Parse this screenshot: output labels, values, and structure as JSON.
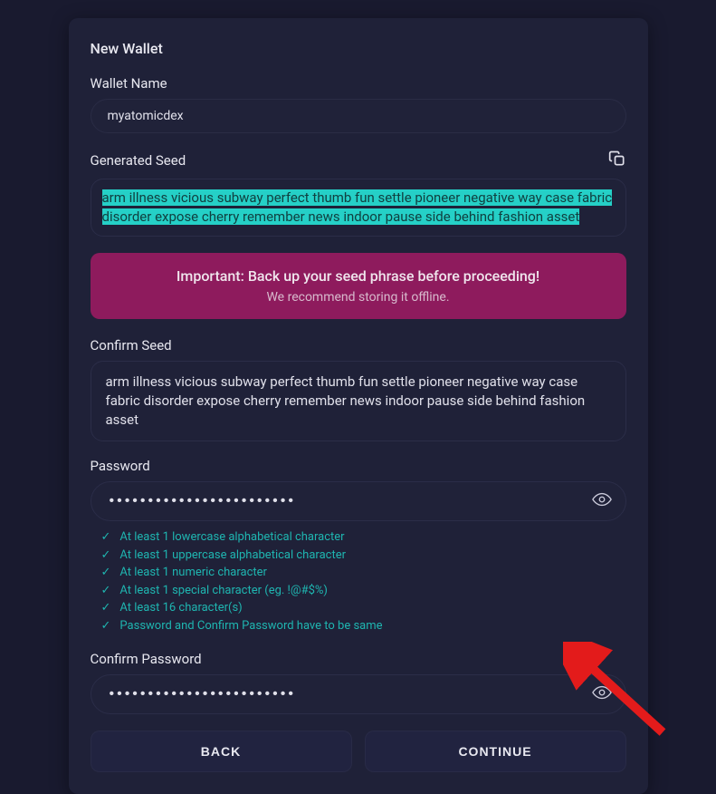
{
  "title": "New Wallet",
  "walletName": {
    "label": "Wallet Name",
    "value": "myatomicdex"
  },
  "generatedSeed": {
    "label": "Generated Seed",
    "value": "arm illness vicious subway perfect thumb fun settle pioneer negative way case fabric disorder expose cherry remember news indoor pause side behind fashion asset"
  },
  "important": {
    "title": "Important: Back up your seed phrase before proceeding!",
    "sub": "We recommend storing it offline."
  },
  "confirmSeed": {
    "label": "Confirm Seed",
    "value": "arm illness vicious subway perfect thumb fun settle pioneer negative way case fabric disorder expose cherry remember news indoor pause side behind fashion asset"
  },
  "password": {
    "label": "Password",
    "value": "••••••••••••••••••••••••"
  },
  "checks": [
    "At least 1 lowercase alphabetical character",
    "At least 1 uppercase alphabetical character",
    "At least 1 numeric character",
    "At least 1 special character (eg. !@#$%)",
    "At least 16 character(s)",
    "Password and Confirm Password have to be same"
  ],
  "confirmPassword": {
    "label": "Confirm Password",
    "value": "••••••••••••••••••••••••"
  },
  "buttons": {
    "back": "BACK",
    "continue": "CONTINUE"
  }
}
